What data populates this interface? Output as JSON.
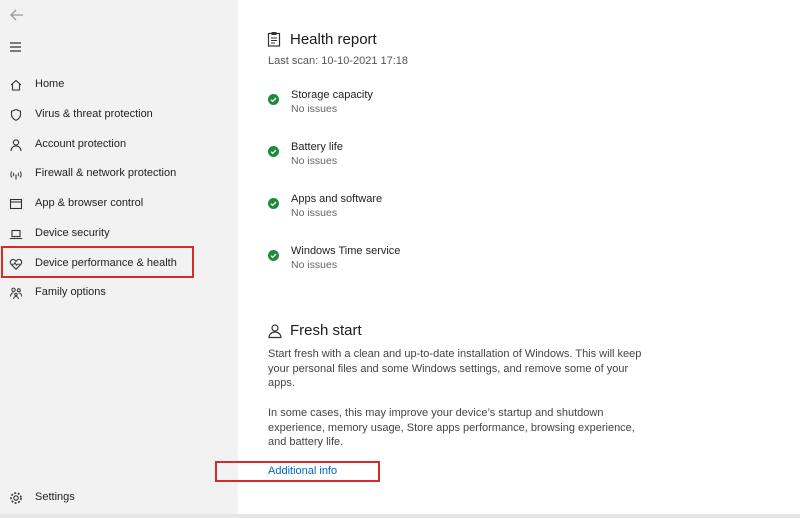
{
  "nav": {
    "items": [
      {
        "label": "Home",
        "icon": "home-icon"
      },
      {
        "label": "Virus & threat protection",
        "icon": "shield-icon"
      },
      {
        "label": "Account protection",
        "icon": "person-icon"
      },
      {
        "label": "Firewall & network protection",
        "icon": "wifi-icon"
      },
      {
        "label": "App & browser control",
        "icon": "browser-window-icon"
      },
      {
        "label": "Device security",
        "icon": "laptop-icon"
      },
      {
        "label": "Device performance & health",
        "icon": "heart-pulse-icon"
      },
      {
        "label": "Family options",
        "icon": "family-icon"
      }
    ],
    "settings_label": "Settings"
  },
  "health_report": {
    "title": "Health report",
    "last_scan": "Last scan: 10-10-2021 17:18",
    "items": [
      {
        "title": "Storage capacity",
        "status": "No issues"
      },
      {
        "title": "Battery life",
        "status": "No issues"
      },
      {
        "title": "Apps and software",
        "status": "No issues"
      },
      {
        "title": "Windows Time service",
        "status": "No issues"
      }
    ]
  },
  "fresh_start": {
    "title": "Fresh start",
    "para1": "Start fresh with a clean and up-to-date installation of Windows. This will keep your personal files and some Windows settings, and remove some of your apps.",
    "para2": "In some cases, this may improve your device’s startup and shutdown experience, memory usage, Store apps performance, browsing experience, and battery life.",
    "link": "Additional info"
  },
  "colors": {
    "check_green": "#1e8a3c",
    "highlight_red": "#d62b2b",
    "link_blue": "#0067c0",
    "sidebar_bg": "#f2f2f2"
  }
}
